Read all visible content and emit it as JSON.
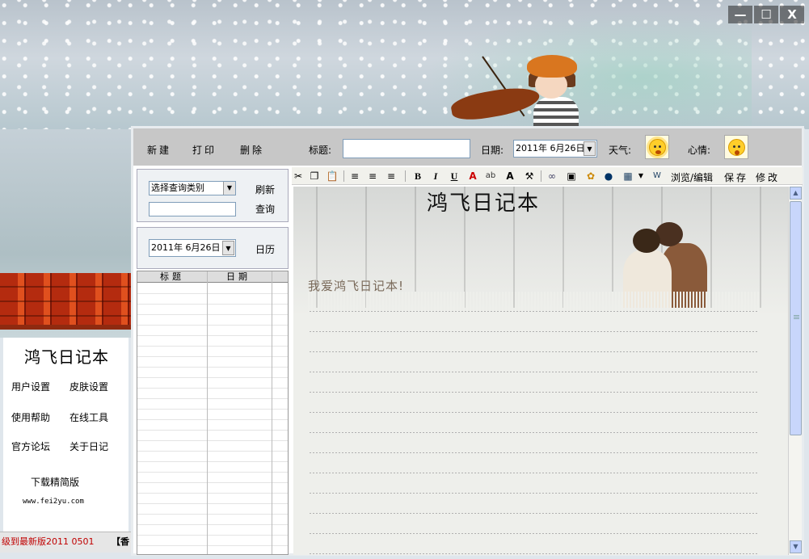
{
  "window": {
    "minimize": "—",
    "maximize": "☐",
    "close": "X"
  },
  "toolbar": {
    "new": "新建",
    "print": "打印",
    "delete": "删除",
    "title_label": "标题:",
    "title_value": "",
    "date_label": "日期:",
    "date_value": "2011年 6月26日",
    "weather_label": "天气:",
    "mood_label": "心情:"
  },
  "query": {
    "category_select": "选择查询类别",
    "search_value": "",
    "refresh": "刷新",
    "search": "查询",
    "calendar_date": "2011年 6月26日",
    "calendar": "日历"
  },
  "list": {
    "col_title": "标题",
    "col_date": "日期"
  },
  "editor_toolbar": {
    "browse_edit": "浏览/编辑",
    "save": "保存",
    "modify": "修改"
  },
  "editor": {
    "heading": "鸿飞日记本",
    "body_text": "我爱鸿飞日记本!"
  },
  "left_menu": {
    "logo": "鸿飞日记本",
    "user_settings": "用户设置",
    "skin_settings": "皮肤设置",
    "help": "使用帮助",
    "online_tools": "在线工具",
    "forum": "官方论坛",
    "about": "关于日记",
    "download_lite": "下载精简版",
    "website": "www.fei2yu.com"
  },
  "status": {
    "upgrade_text": "级到最新版2011 0501",
    "bracket_text": "【香"
  },
  "colors": {
    "status_red": "#c00000",
    "topbar_gray": "#c7c7c7"
  },
  "icons": {
    "weather": "sun-icon",
    "mood": "surprised-face-icon"
  }
}
